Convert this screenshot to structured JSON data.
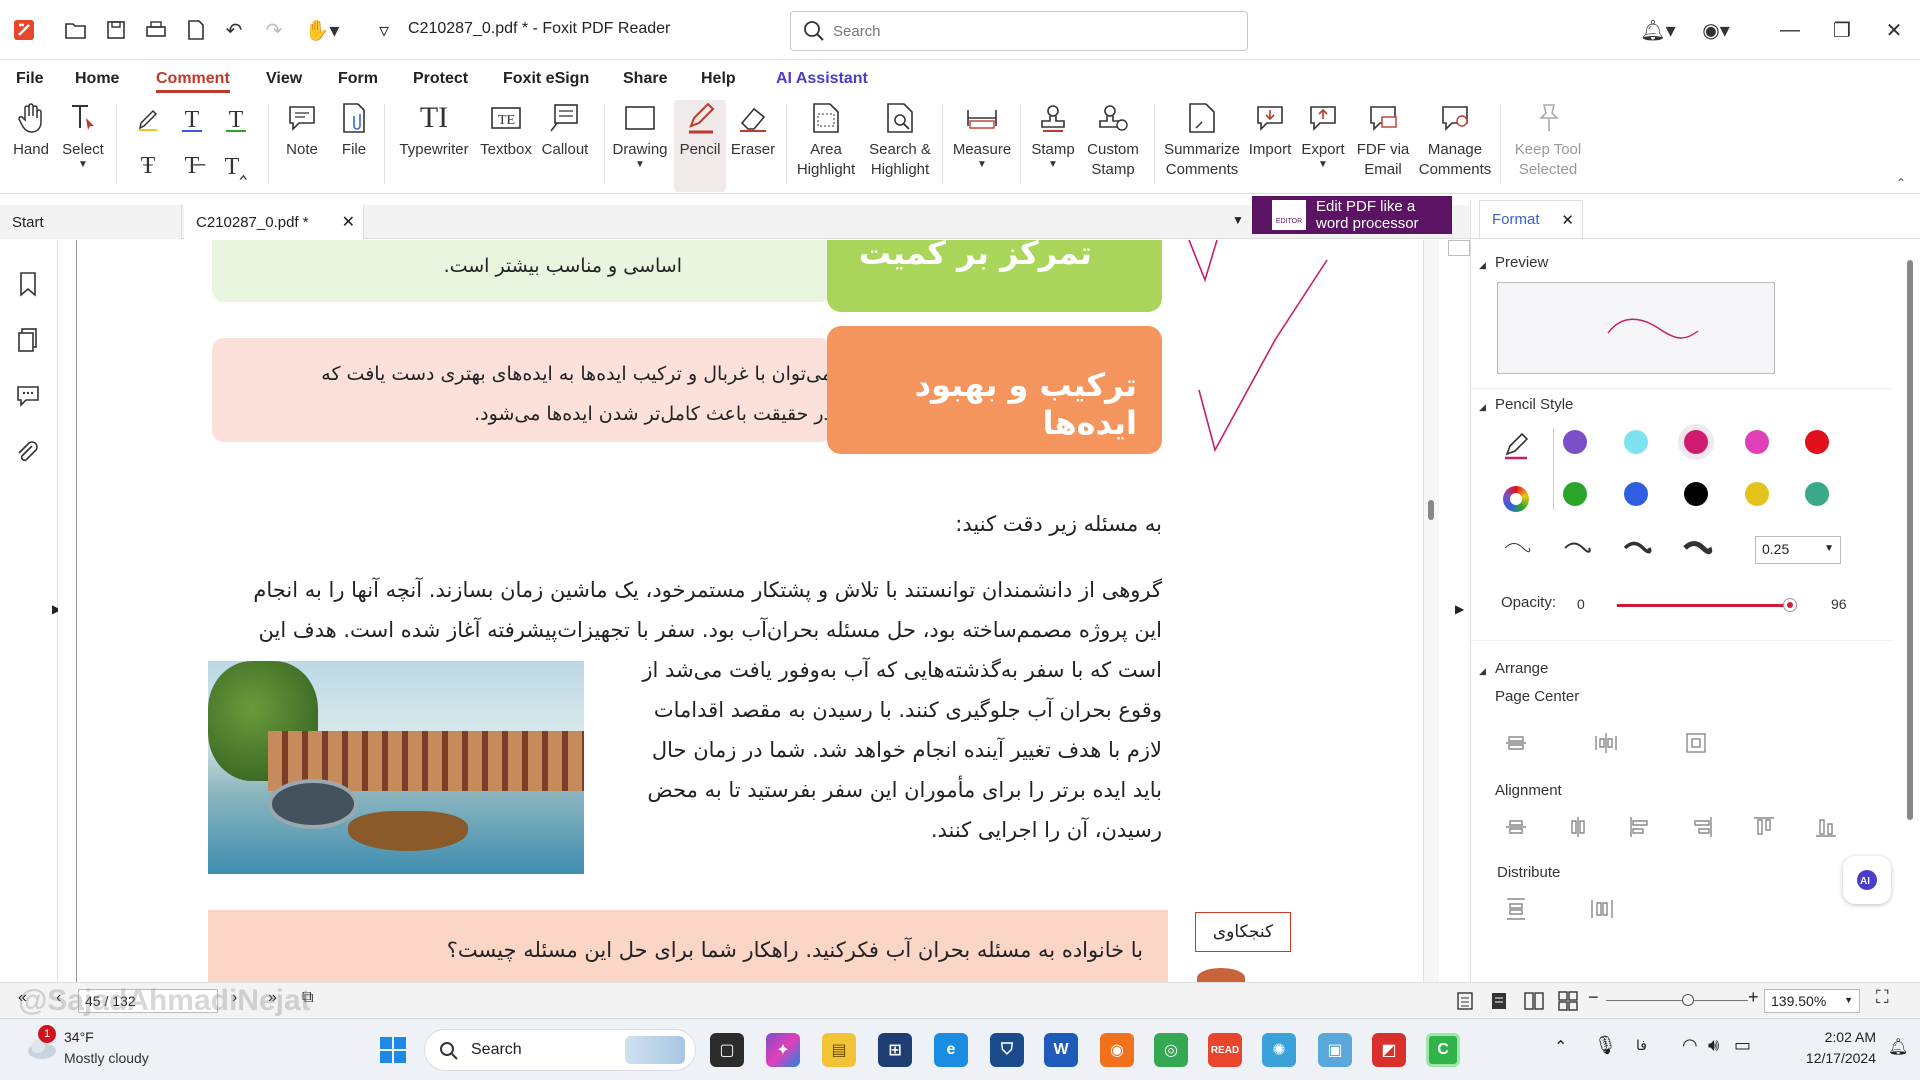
{
  "window": {
    "title": "C210287_0.pdf * - Foxit PDF Reader"
  },
  "search": {
    "placeholder": "Search"
  },
  "menu": [
    "File",
    "Home",
    "Comment",
    "View",
    "Form",
    "Protect",
    "Foxit eSign",
    "Share",
    "Help",
    "AI Assistant"
  ],
  "ribbon": {
    "hand": "Hand",
    "select": "Select",
    "note": "Note",
    "file": "File",
    "typewriter": "Typewriter",
    "textbox": "Textbox",
    "callout": "Callout",
    "drawing": "Drawing",
    "pencil": "Pencil",
    "eraser": "Eraser",
    "area_highlight_1": "Area",
    "area_highlight_2": "Highlight",
    "search_highlight_1": "Search &",
    "search_highlight_2": "Highlight",
    "measure": "Measure",
    "stamp": "Stamp",
    "custom_stamp_1": "Custom",
    "custom_stamp_2": "Stamp",
    "summarize_1": "Summarize",
    "summarize_2": "Comments",
    "import": "Import",
    "export": "Export",
    "fdf_1": "FDF via",
    "fdf_2": "Email",
    "manage_1": "Manage",
    "manage_2": "Comments",
    "keep_1": "Keep Tool",
    "keep_2": "Selected"
  },
  "tabs": {
    "start": "Start",
    "doc": "C210287_0.pdf *"
  },
  "banner": {
    "line1": "Edit PDF like a",
    "line2": "word processor",
    "logo": "EDITOR"
  },
  "document": {
    "green_box_title": "تمرکز بر کمیت",
    "green_box_text": "اساسی و مناسب بیشتر است.",
    "orange_box_title": "ترکیب و بهبود ایده‌ها",
    "orange_box_line1": "می‌توان با غربال و ترکیب ایده‌ها به ایده‌های بهتری دست یافت که",
    "orange_box_line2": "در حقیقت باعث کامل‌تر شدن ایده‌ها می‌شود.",
    "prompt": "به مسئله زیر دقت کنید:",
    "para_line1": "گروهی از دانشمندان توانستند با تلاش و پشتکار مستمرخود، یک ماشین زمان بسازند. آنچه آنها را به انجام",
    "para_line2": "این پروژه مصمم‌ساخته بود، حل مسئله بحران‌آب بود. سفر با تجهیزات‌پیشرفته آغاز شده است. هدف این",
    "para_line3": "است که با سفر به‌گذشته‌هایی که آب به‌وفور یافت می‌شد از",
    "para_line4": "وقوع بحران آب جلوگیری کنند. با رسیدن به مقصد اقدامات",
    "para_line5": "لازم با هدف تغییر آینده انجام خواهد شد. شما در زمان حال",
    "para_line6": "باید ایده برتر را برای مأموران این سفر بفرستید تا به محض",
    "para_line7": "رسیدن، آن را اجرایی کنند.",
    "curiosity_label": "کنجکاوی",
    "bottom_question": "با خانواده به مسئله بحران آب فکرکنید. راهکار شما برای حل این مسئله چیست؟"
  },
  "format_panel": {
    "tab": "Format",
    "preview": "Preview",
    "pencil_style": "Pencil Style",
    "width_value": "0.25",
    "opacity_label": "Opacity:",
    "opacity_min": "0",
    "opacity_value": 96,
    "arrange": "Arrange",
    "page_center": "Page Center",
    "alignment": "Alignment",
    "distribute": "Distribute",
    "colors": [
      "#7b4fc9",
      "#7fe3ef",
      "#cf1b6f",
      "#e13fb8",
      "#e0101b",
      "#2aa52a",
      "#2f5fe0",
      "#000000",
      "#e3c21c",
      "#3aa98a"
    ],
    "selected_color": "#cf1b6f"
  },
  "status": {
    "page": "45 / 132",
    "zoom": "139.50%",
    "watermark": "@SajadAhmadiNejat"
  },
  "taskbar": {
    "temp": "34°F",
    "weather": "Mostly cloudy",
    "search": "Search",
    "notif": "1",
    "time": "2:02 AM",
    "date": "12/17/2024",
    "lang": "فا"
  }
}
